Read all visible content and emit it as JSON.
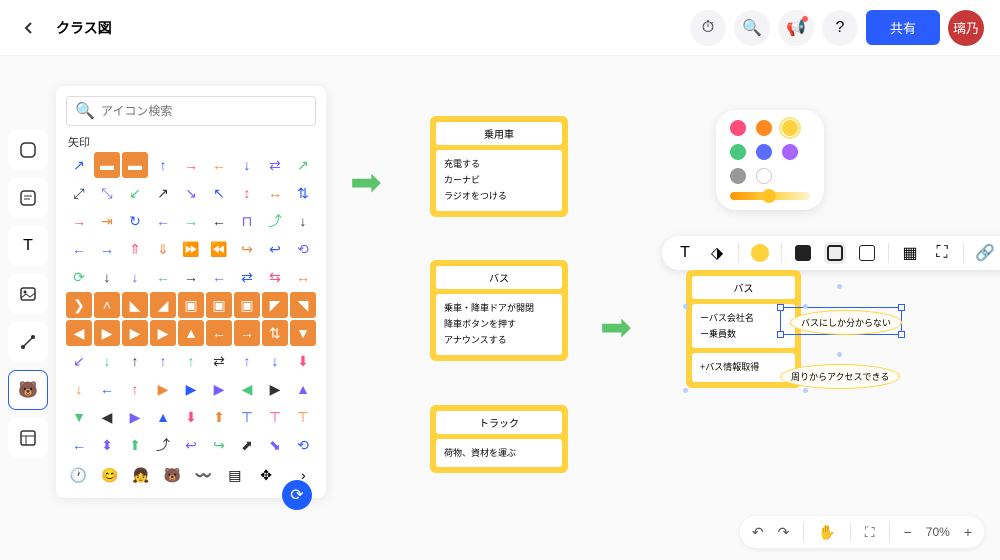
{
  "header": {
    "title": "クラス図",
    "share": "共有",
    "avatar": "璃乃"
  },
  "search": {
    "placeholder": "アイコン検索"
  },
  "sectionLabel": "矢印",
  "cards": {
    "car": {
      "title": "乗用車",
      "body": "充電する\nカーナビ\nラジオをつける"
    },
    "bus1": {
      "title": "バス",
      "body": "乗車・降車ドアが開閉\n降車ボタンを押す\nアナウンスする"
    },
    "truck": {
      "title": "トラック",
      "body": "荷物、資材を運ぶ"
    },
    "bus2": {
      "title": "バス",
      "body1": "ーバス会社名\nー乗員数",
      "body2": "+バス情報取得"
    }
  },
  "annot": {
    "a1": "バスにしか分からない",
    "a2": "周りからアクセスできる"
  },
  "zoom": "70%",
  "colors": {
    "pink": "#ff4d7d",
    "orange": "#ff8b1e",
    "yellow": "#ffd23f",
    "green": "#4ac97e",
    "blue": "#5b6dff",
    "purple": "#a765ff",
    "gray": "#999",
    "white": "#fff"
  }
}
